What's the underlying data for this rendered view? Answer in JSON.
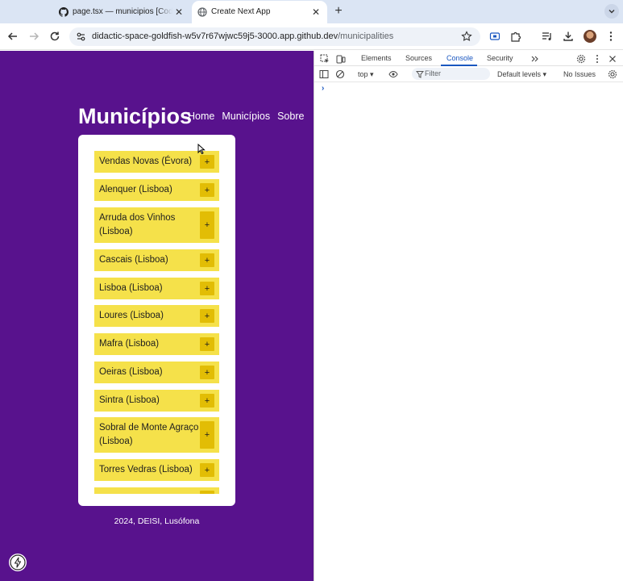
{
  "browser": {
    "tabs": [
      {
        "title": "page.tsx — municipios [Code",
        "icon": "github-icon",
        "active": false
      },
      {
        "title": "Create Next App",
        "icon": "globe-icon",
        "active": true
      }
    ],
    "new_tab_label": "+",
    "url_host": "didactic-space-goldfish-w5v7r67wjwc59j5-3000.app.github.dev",
    "url_path": "/municipalities"
  },
  "page": {
    "title": "Municípios",
    "nav": [
      "Home",
      "Municípios",
      "Sobre"
    ],
    "municipalities": [
      {
        "name": "Vendas Novas (Évora)",
        "button": "+"
      },
      {
        "name": "Alenquer (Lisboa)",
        "button": "+"
      },
      {
        "name": "Arruda dos Vinhos (Lisboa)",
        "button": "+"
      },
      {
        "name": "Cascais (Lisboa)",
        "button": "+"
      },
      {
        "name": "Lisboa (Lisboa)",
        "button": "+"
      },
      {
        "name": "Loures (Lisboa)",
        "button": "+"
      },
      {
        "name": "Mafra (Lisboa)",
        "button": "+"
      },
      {
        "name": "Oeiras (Lisboa)",
        "button": "+"
      },
      {
        "name": "Sintra (Lisboa)",
        "button": "+"
      },
      {
        "name": "Sobral de Monte Agraço (Lisboa)",
        "button": "+"
      },
      {
        "name": "Torres Vedras (Lisboa)",
        "button": "+"
      }
    ],
    "footer": "2024, DEISI, Lusófona",
    "colors": {
      "background": "#58128d",
      "item": "#f5e14a",
      "item_button": "#e2bd05"
    }
  },
  "devtools": {
    "tabs": [
      "Elements",
      "Sources",
      "Console",
      "Security"
    ],
    "active_tab": "Console",
    "context": "top",
    "filter_placeholder": "Filter",
    "levels": "Default levels",
    "issues": "No Issues",
    "prompt": "›",
    "accent": "#1a57c0"
  }
}
